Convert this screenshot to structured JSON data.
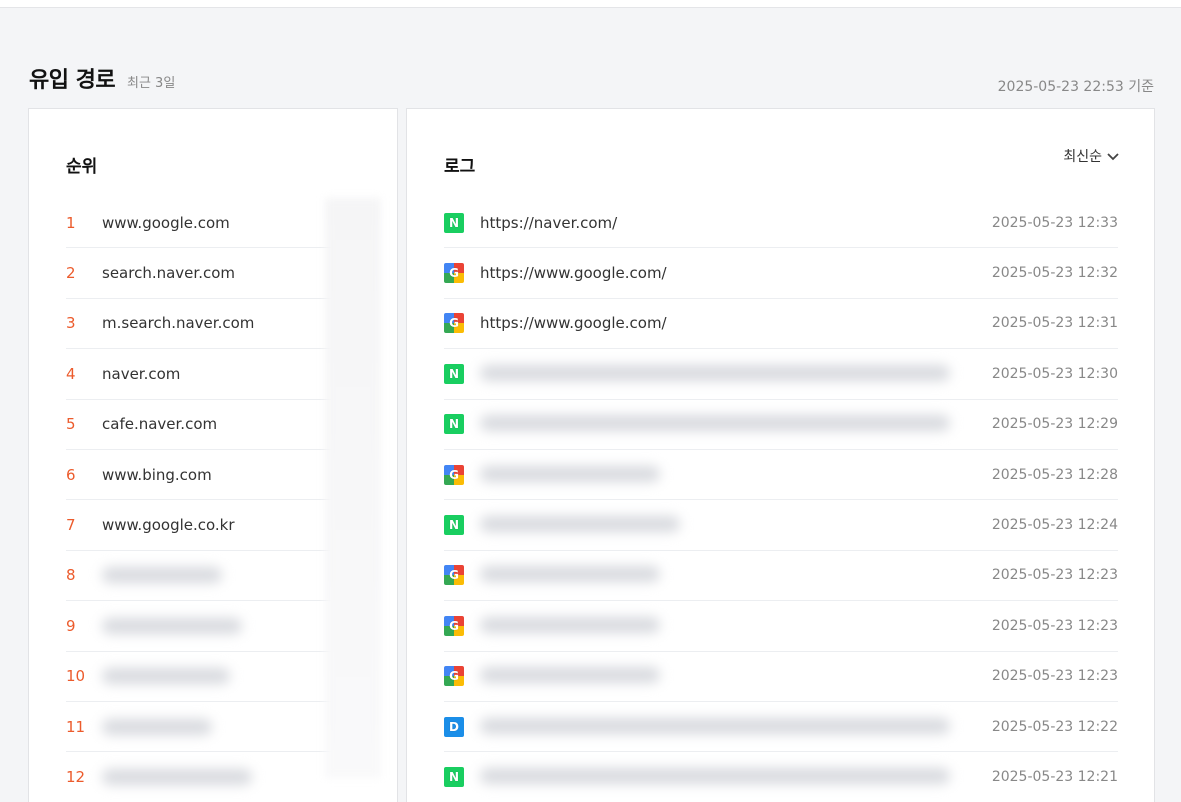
{
  "header": {
    "title": "유입 경로",
    "subtitle": "최근 3일",
    "as_of": "2025-05-23 22:53 기준"
  },
  "rank_panel": {
    "title": "순위",
    "items": [
      {
        "rank": "1",
        "domain": "www.google.com"
      },
      {
        "rank": "2",
        "domain": "search.naver.com"
      },
      {
        "rank": "3",
        "domain": "m.search.naver.com"
      },
      {
        "rank": "4",
        "domain": "naver.com"
      },
      {
        "rank": "5",
        "domain": "cafe.naver.com"
      },
      {
        "rank": "6",
        "domain": "www.bing.com"
      },
      {
        "rank": "7",
        "domain": "www.google.co.kr"
      },
      {
        "rank": "8",
        "domain": ""
      },
      {
        "rank": "9",
        "domain": ""
      },
      {
        "rank": "10",
        "domain": ""
      },
      {
        "rank": "11",
        "domain": ""
      },
      {
        "rank": "12",
        "domain": ""
      }
    ]
  },
  "log_panel": {
    "title": "로그",
    "sort_label": "최신순",
    "entries": [
      {
        "source": "naver",
        "icon": "naver-icon",
        "url": "https://naver.com/",
        "time": "2025-05-23 12:33"
      },
      {
        "source": "google",
        "icon": "google-icon",
        "url": "https://www.google.com/",
        "time": "2025-05-23 12:32"
      },
      {
        "source": "google",
        "icon": "google-icon",
        "url": "https://www.google.com/",
        "time": "2025-05-23 12:31"
      },
      {
        "source": "naver",
        "icon": "naver-icon",
        "url": "",
        "time": "2025-05-23 12:30"
      },
      {
        "source": "naver",
        "icon": "naver-icon",
        "url": "",
        "time": "2025-05-23 12:29"
      },
      {
        "source": "google",
        "icon": "google-icon",
        "url": "",
        "time": "2025-05-23 12:28"
      },
      {
        "source": "naver",
        "icon": "naver-icon",
        "url": "",
        "time": "2025-05-23 12:24"
      },
      {
        "source": "google",
        "icon": "google-icon",
        "url": "",
        "time": "2025-05-23 12:23"
      },
      {
        "source": "google",
        "icon": "google-icon",
        "url": "",
        "time": "2025-05-23 12:23"
      },
      {
        "source": "google",
        "icon": "google-icon",
        "url": "",
        "time": "2025-05-23 12:23"
      },
      {
        "source": "daum",
        "icon": "daum-icon",
        "url": "",
        "time": "2025-05-23 12:22"
      },
      {
        "source": "naver",
        "icon": "naver-icon",
        "url": "",
        "time": "2025-05-23 12:21"
      }
    ]
  },
  "colors": {
    "rank_number": "#ec5b2c",
    "naver": "#19ce60",
    "daum": "#1b8ee8",
    "background": "#f4f5f7"
  }
}
